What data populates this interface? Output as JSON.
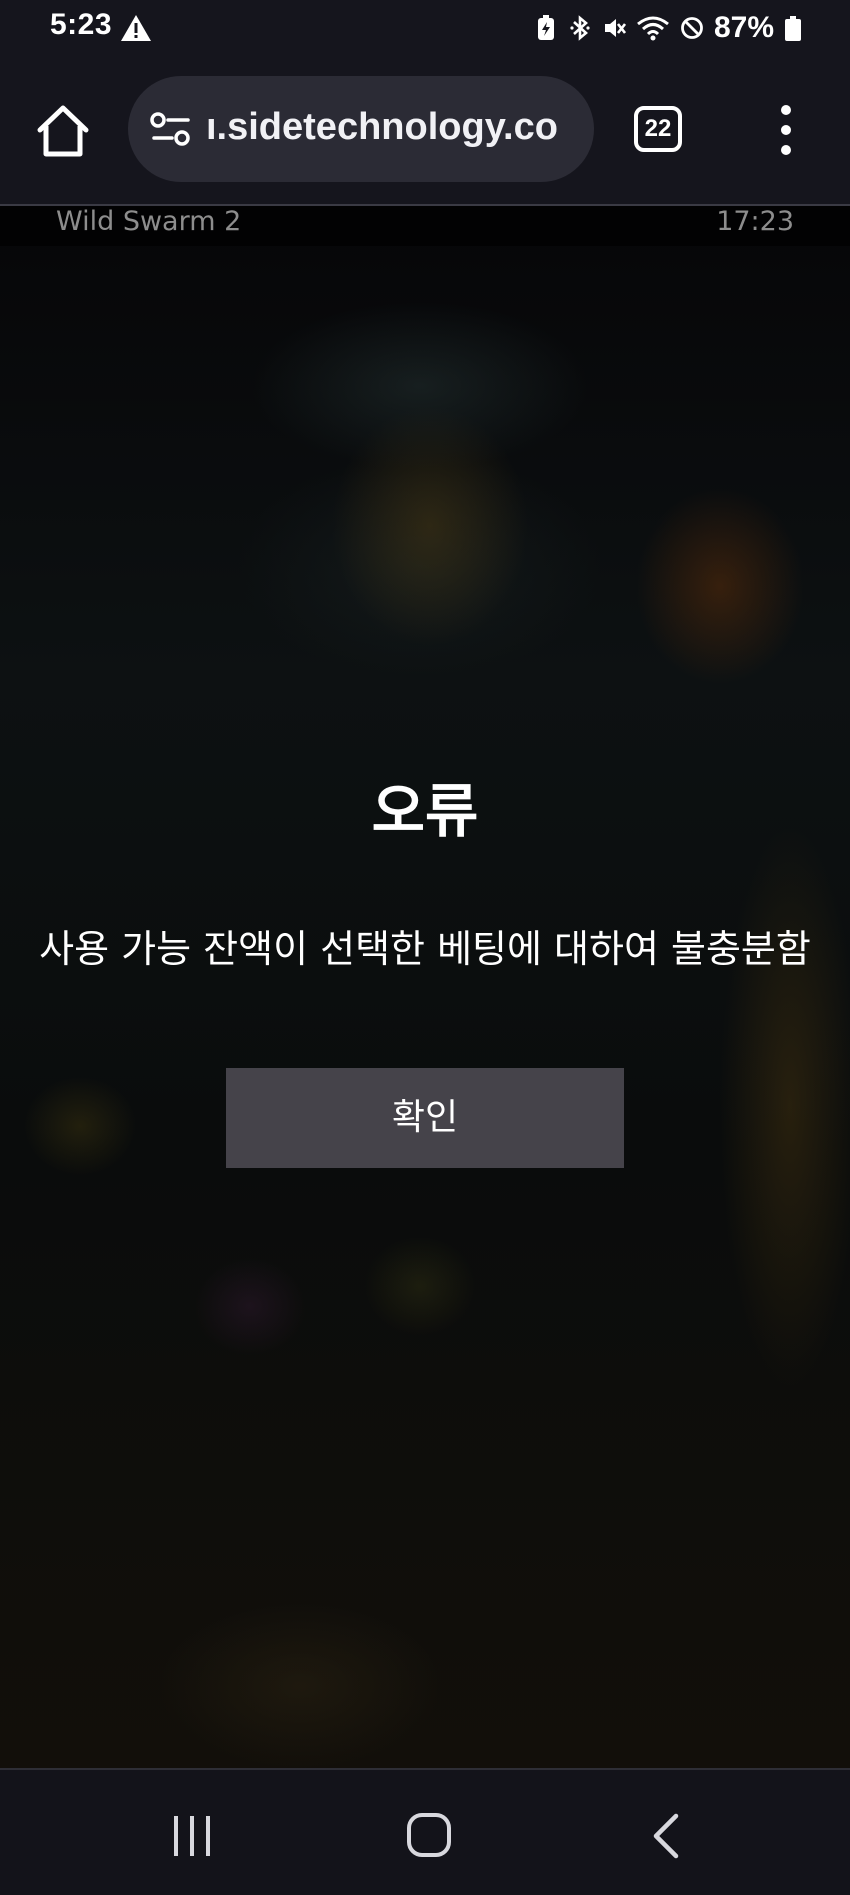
{
  "status_bar": {
    "time": "5:23",
    "battery_percent": "87%",
    "icons": [
      "warning-icon",
      "battery-saver-icon",
      "bluetooth-icon",
      "mute-icon",
      "wifi-icon",
      "do-not-disturb-icon",
      "battery-icon"
    ]
  },
  "browser": {
    "url": "ı.sidetechnology.co",
    "tab_count": "22",
    "icons": [
      "home-icon",
      "site-settings-icon",
      "more-options-icon"
    ]
  },
  "game": {
    "title": "Wild Swarm 2",
    "clock": "17:23"
  },
  "dialog": {
    "title": "오류",
    "message": "사용 가능 잔액이 선택한 베팅에 대하여 불충분함",
    "confirm_label": "확인"
  },
  "nav_bar": {
    "icons": [
      "recent-apps-icon",
      "home-icon",
      "back-icon"
    ]
  },
  "colors": {
    "status_bg": "#15151d",
    "url_pill_bg": "#2b2b35",
    "dialog_button_bg": "#45434a",
    "game_header_text": "#8d8d8d"
  }
}
